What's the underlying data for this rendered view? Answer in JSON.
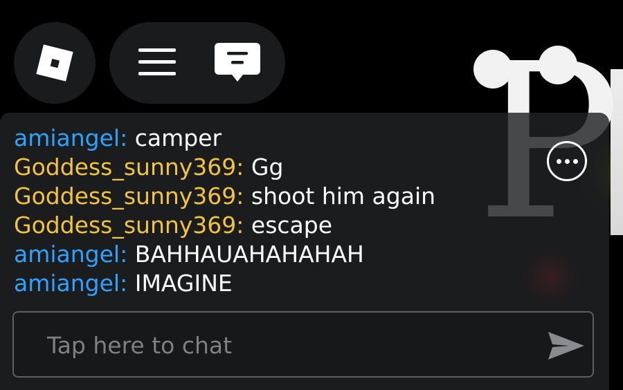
{
  "top_bar": {
    "logo_icon": "roblox-logo-icon",
    "menu_icon": "hamburger-menu-icon",
    "chat_icon": "chat-bubble-icon"
  },
  "chat": {
    "messages": [
      {
        "name": "amiangel:",
        "text": "camper",
        "name_color": "#2ea2ff"
      },
      {
        "name": "Goddess_sunny369:",
        "text": "Gg",
        "name_color": "#f3c43c"
      },
      {
        "name": "Goddess_sunny369:",
        "text": "shoot him again",
        "name_color": "#f3c43c"
      },
      {
        "name": "Goddess_sunny369:",
        "text": "escape",
        "name_color": "#f3c43c"
      },
      {
        "name": "amiangel:",
        "text": "BAHHAUAHAHAHAH",
        "name_color": "#2ea2ff"
      },
      {
        "name": "amiangel:",
        "text": "IMAGINE",
        "name_color": "#2ea2ff"
      }
    ],
    "more_icon": "more-options-icon",
    "input": {
      "placeholder": "Tap here to chat",
      "value": ""
    },
    "send_icon": "send-icon"
  },
  "background": {
    "letter": "P"
  },
  "colors": {
    "chat_bg": "#202225",
    "player_blue": "#2ea2ff",
    "player_gold": "#f3c43c",
    "placeholder": "#7f8083"
  }
}
